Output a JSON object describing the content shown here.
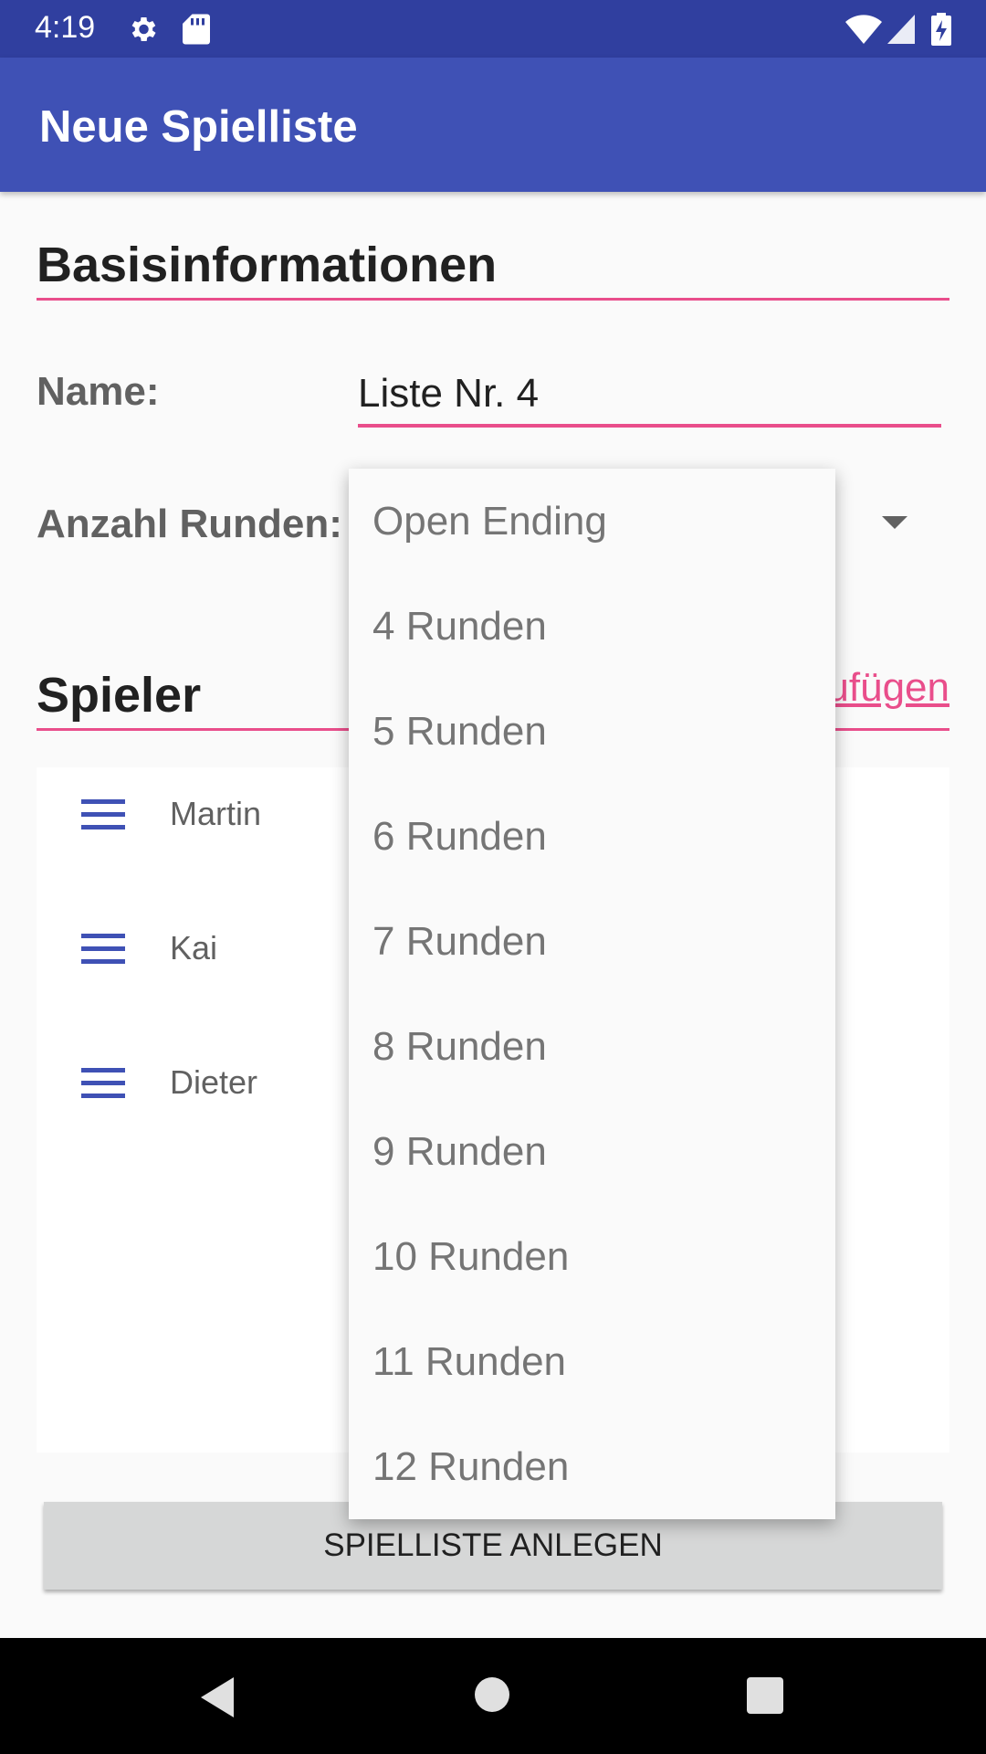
{
  "status_bar": {
    "time": "4:19"
  },
  "app_bar": {
    "title": "Neue Spielliste"
  },
  "basis": {
    "heading": "Basisinformationen",
    "name_label": "Name:",
    "name_value": "Liste Nr. 4",
    "rounds_label": "Anzahl Runden:"
  },
  "players": {
    "heading": "Spieler",
    "add_label": "ufügen",
    "list": [
      "Martin",
      "Kai",
      "Dieter"
    ]
  },
  "create_button": "SPIELLISTE ANLEGEN",
  "dropdown": {
    "options": [
      "Open Ending",
      "4 Runden",
      "5 Runden",
      "6 Runden",
      "7 Runden",
      "8 Runden",
      "9 Runden",
      "10 Runden",
      "11 Runden",
      "12 Runden"
    ]
  },
  "colors": {
    "primary": "#3f51b5",
    "primary_dark": "#303f9f",
    "accent": "#e94e8b"
  }
}
